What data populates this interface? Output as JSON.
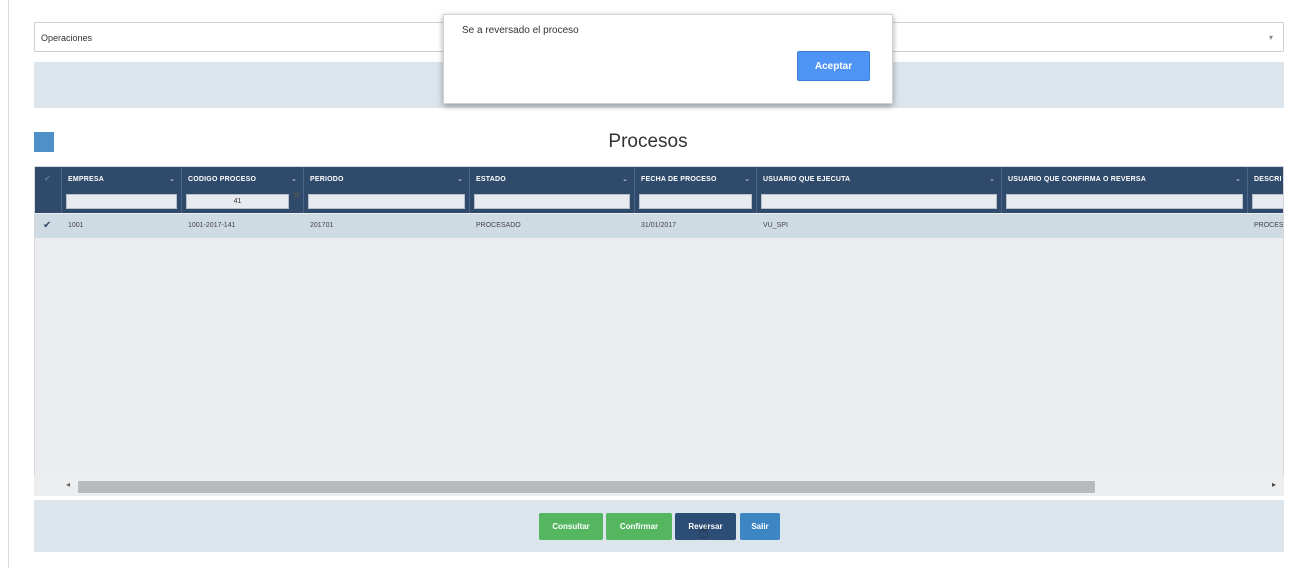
{
  "operations_select": {
    "value": "Operaciones",
    "caret": "▾"
  },
  "section": {
    "title": "Procesos"
  },
  "dialog": {
    "message": "Se a reversado el proceso",
    "ok_label": "Aceptar"
  },
  "grid": {
    "columns": [
      {
        "label": "EMPRESA",
        "filter": ""
      },
      {
        "label": "CODIGO PROCESO",
        "filter": "41"
      },
      {
        "label": "PERIODO",
        "filter": ""
      },
      {
        "label": "ESTADO",
        "filter": ""
      },
      {
        "label": "FECHA DE PROCESO",
        "filter": ""
      },
      {
        "label": "USUARIO QUE EJECUTA",
        "filter": ""
      },
      {
        "label": "USUARIO QUE CONFIRMA O REVERSA",
        "filter": ""
      },
      {
        "label": "DESCRI",
        "filter": ""
      }
    ],
    "rows": [
      {
        "empresa": "1001",
        "codigo_proceso": "1001-2017-141",
        "periodo": "201701",
        "estado": "PROCESADO",
        "fecha_de_proceso": "31/01/2017",
        "usuario_que_ejecuta": "VU_SPI",
        "usuario_que_confirma": "",
        "descripcion": "PROCES"
      }
    ]
  },
  "buttons": {
    "consultar": "Consultar",
    "confirmar": "Confirmar",
    "reversar": "Reversar",
    "salir": "Salir"
  },
  "colors": {
    "header": "#2f4a6b",
    "accent_blue": "#4e91c8",
    "success": "#54b760",
    "dialog_button": "#4e94f5"
  }
}
